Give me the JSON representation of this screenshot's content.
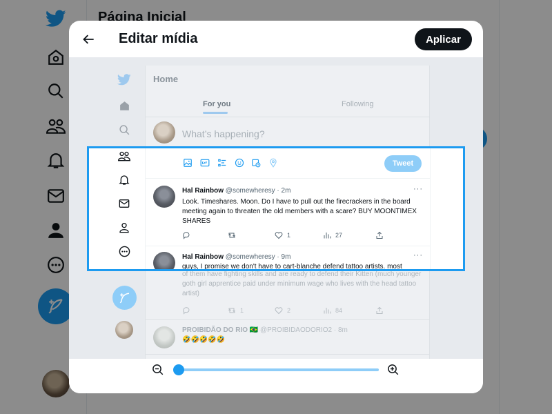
{
  "background": {
    "page_title": "Página Inicial",
    "nav_icons": [
      "twitter-logo-icon",
      "home-icon",
      "search-icon",
      "communities-icon",
      "notifications-icon",
      "messages-icon",
      "profile-icon",
      "more-icon"
    ],
    "compose_icon": "feather-icon"
  },
  "modal": {
    "title": "Editar mídia",
    "apply_label": "Aplicar",
    "back_icon": "arrow-left-icon"
  },
  "screenshot": {
    "home_title": "Home",
    "tabs": [
      "For you",
      "Following"
    ],
    "active_tab": "For you",
    "composer_placeholder": "What’s happening?",
    "tweet_button": "Tweet",
    "tweets": [
      {
        "name": "Hal Rainbow",
        "handle_time": "@somewheresy · 2m",
        "text": "Look. Timeshares. Moon. Do I have to pull out the firecrackers in the board meeting again to threaten the old members with a scare? BUY MOONTIMEX SHARES",
        "likes": "1",
        "views": "27"
      },
      {
        "name": "Hal Rainbow",
        "handle_time": "@somewheresy · 9m",
        "text_line1": "guys, I promise we don't have to cart-blanche defend tattoo artists. most",
        "text_rest": "of them have fighting skills and are ready to defend their Kitten (much younger goth girl apprentice paid under minimum wage who lives with the head tattoo artist)",
        "retweets": "1",
        "likes": "2",
        "views": "84"
      },
      {
        "name": "PROIBIDÃO DO RIO 🇧🇷",
        "handle_time": "@PROIBIDAODORIO2 · 8m",
        "text": "🤣🤣🤣🤣🤣"
      }
    ]
  },
  "zoom": {
    "level": 0.0,
    "zoom_out_icon": "zoom-out-icon",
    "zoom_in_icon": "zoom-in-icon"
  },
  "colors": {
    "accent": "#1d9bf0",
    "dark": "#0f1419"
  }
}
